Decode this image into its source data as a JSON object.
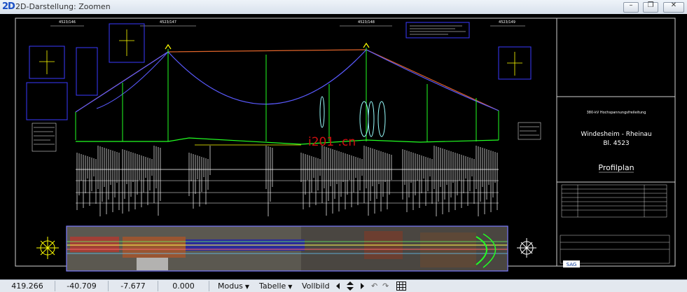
{
  "window": {
    "app_icon": "2D",
    "title": "2D-Darstellung: Zoomen",
    "buttons": {
      "minimize": "–",
      "restore": "❐",
      "close": "✕"
    }
  },
  "drawing": {
    "mast_labels": [
      "4523/146",
      "4523/147",
      "4523/148",
      "4523/149"
    ],
    "watermark": "i201 .cn",
    "title_block": {
      "header": "380-kV Hochspannungsfreileitung",
      "route": "Windesheim - Rheinau",
      "sheet": "Bl. 4523",
      "plan_title": "Profilplan",
      "logo": "SAG"
    }
  },
  "status": {
    "x": "419.266",
    "y": "-40.709",
    "z": "-7.677",
    "value": "0.000",
    "menus": [
      "Modus",
      "Tabelle"
    ],
    "vollbild": "Vollbild"
  },
  "icons": [
    "app-2d-icon",
    "minimize-icon",
    "restore-icon",
    "close-icon",
    "compass-icon",
    "pan-arrows-icon",
    "undo-icon",
    "redo-icon",
    "grid-icon"
  ]
}
